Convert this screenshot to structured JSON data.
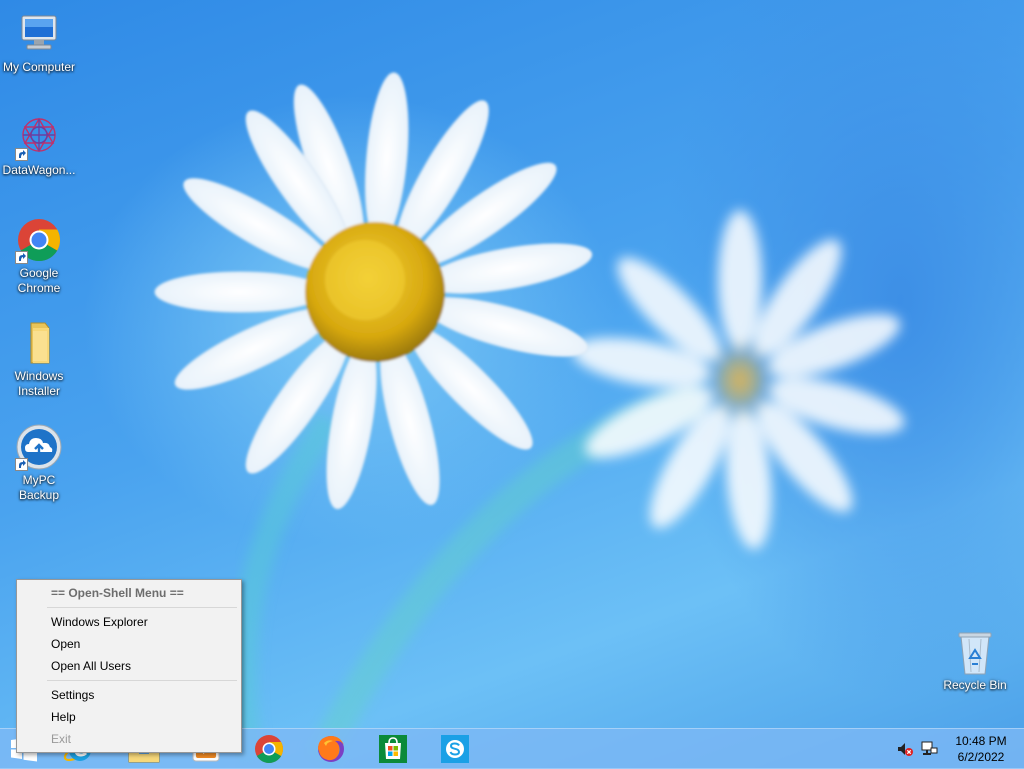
{
  "desktop": {
    "icons": [
      {
        "label": "My Computer"
      },
      {
        "label": "DataWagon..."
      },
      {
        "label": "Google Chrome"
      },
      {
        "label": "Windows Installer"
      },
      {
        "label": "MyPC Backup"
      },
      {
        "label": "Recycle Bin"
      }
    ]
  },
  "context_menu": {
    "header": "== Open-Shell Menu ==",
    "items": [
      "Windows Explorer",
      "Open",
      "Open All Users",
      "Settings",
      "Help",
      "Exit"
    ]
  },
  "taskbar": {
    "pinned": [
      {
        "icon": "internet-explorer-icon"
      },
      {
        "icon": "file-explorer-icon"
      },
      {
        "icon": "media-player-icon"
      },
      {
        "icon": "chrome-icon"
      },
      {
        "icon": "firefox-icon"
      },
      {
        "icon": "store-icon"
      },
      {
        "icon": "skype-icon"
      }
    ],
    "tray": {
      "volume": "volume-muted-icon",
      "network": "network-icon"
    },
    "clock": {
      "time": "10:48 PM",
      "date": "6/2/2022"
    }
  }
}
